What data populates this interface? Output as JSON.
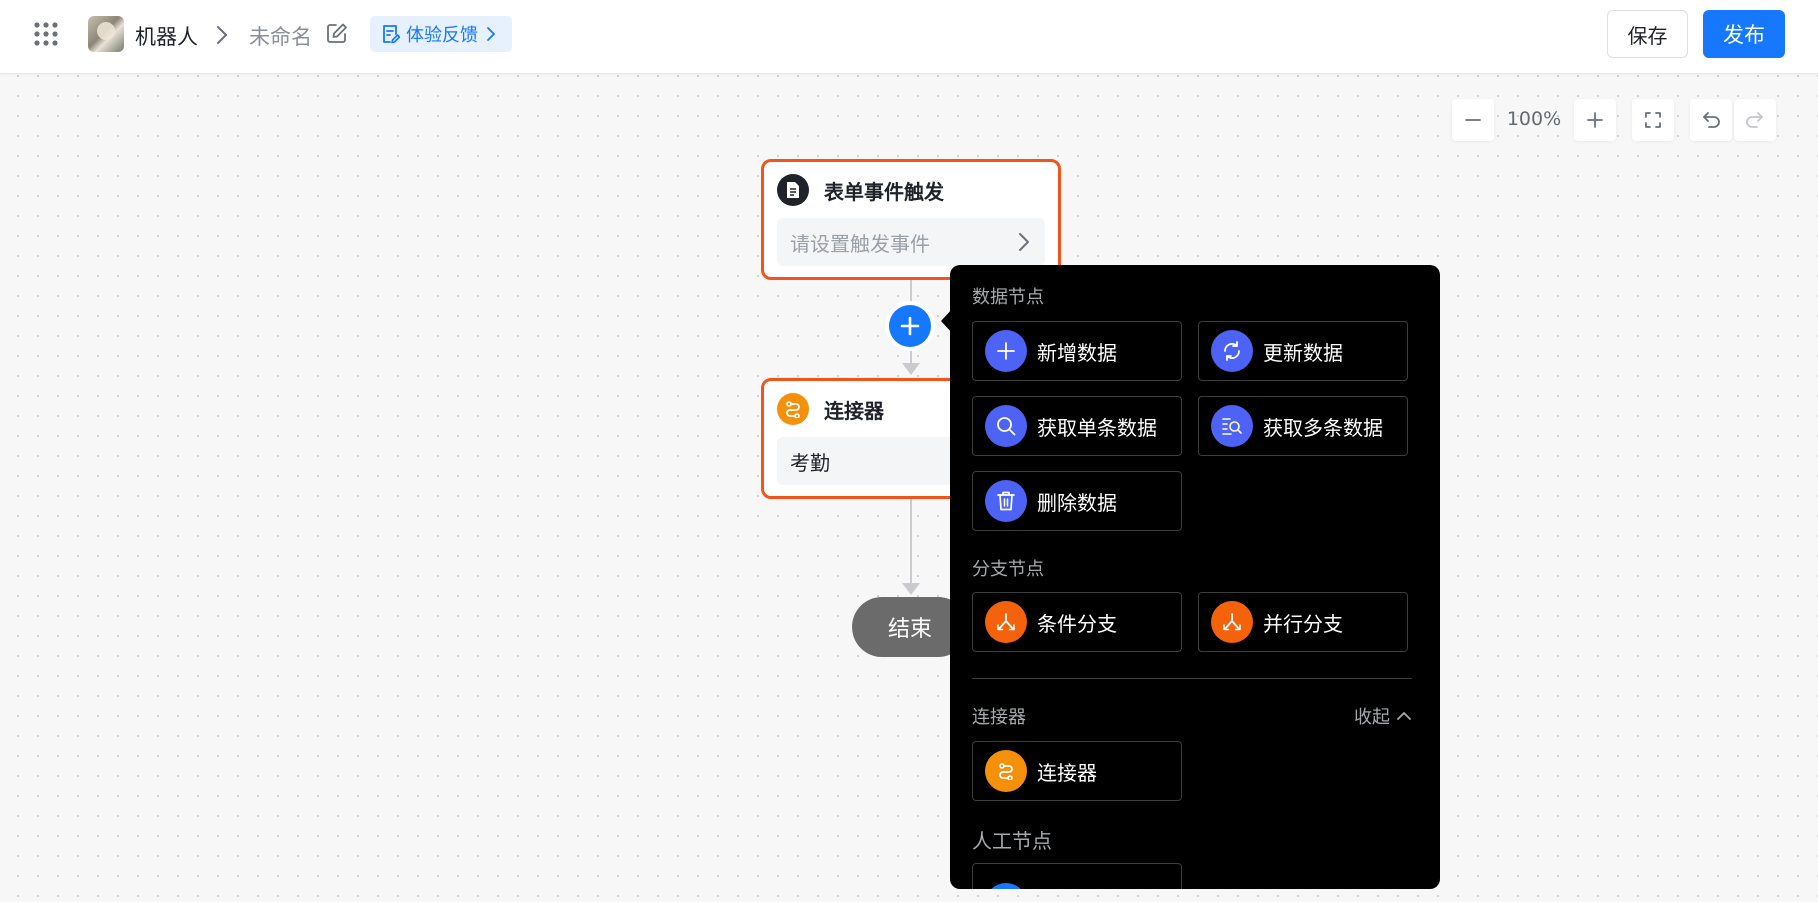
{
  "header": {
    "app_name": "机器人",
    "doc_name": "未命名",
    "feedback_label": "体验反馈",
    "save_label": "保存",
    "publish_label": "发布"
  },
  "toolbar": {
    "zoom_level": "100%"
  },
  "flow": {
    "trigger_node": {
      "title": "表单事件触发",
      "placeholder": "请设置触发事件"
    },
    "connector_node": {
      "title": "连接器",
      "value": "考勤"
    },
    "end_node": {
      "label": "结束"
    }
  },
  "popover": {
    "data_section_title": "数据节点",
    "data_items": [
      {
        "label": "新增数据",
        "icon": "plus-icon"
      },
      {
        "label": "更新数据",
        "icon": "refresh-icon"
      },
      {
        "label": "获取单条数据",
        "icon": "search-icon"
      },
      {
        "label": "获取多条数据",
        "icon": "list-search-icon"
      },
      {
        "label": "删除数据",
        "icon": "trash-icon"
      }
    ],
    "branch_section_title": "分支节点",
    "branch_items": [
      {
        "label": "条件分支",
        "icon": "branch-icon"
      },
      {
        "label": "并行分支",
        "icon": "branch-icon"
      }
    ],
    "connector_section_title": "连接器",
    "collapse_label": "收起",
    "connector_items": [
      {
        "label": "连接器",
        "icon": "connector-icon"
      }
    ],
    "manual_section_title": "人工节点"
  },
  "colors": {
    "accent": "#1677ff",
    "node_border": "#f2541b",
    "data_icon_bg": "#4c63f5",
    "branch_icon_bg": "#f4630b",
    "connector_icon_bg": "#f5900b"
  }
}
